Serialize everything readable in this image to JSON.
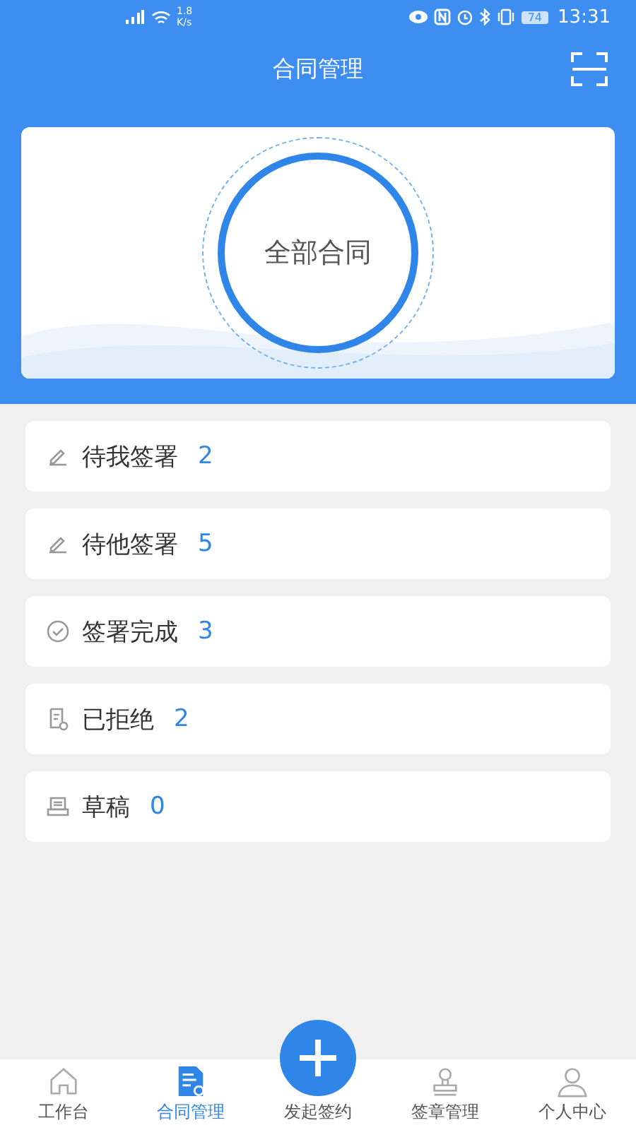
{
  "status_bar": {
    "speed": "1.8",
    "speed_unit": "K/s",
    "battery": "74",
    "time": "13:31"
  },
  "header": {
    "title": "合同管理"
  },
  "summary": {
    "label": "全部合同"
  },
  "items": [
    {
      "kind": "pen",
      "label": "待我签署",
      "count": "2"
    },
    {
      "kind": "pen",
      "label": "待他签署",
      "count": "5"
    },
    {
      "kind": "check",
      "label": "签署完成",
      "count": "3"
    },
    {
      "kind": "rejected",
      "label": "已拒绝",
      "count": "2"
    },
    {
      "kind": "draft",
      "label": "草稿",
      "count": "0"
    }
  ],
  "nav": [
    {
      "kind": "home",
      "label": "工作台",
      "selected": false
    },
    {
      "kind": "contract",
      "label": "合同管理",
      "selected": true
    },
    {
      "kind": "add",
      "label": "发起签约",
      "selected": false
    },
    {
      "kind": "seal",
      "label": "签章管理",
      "selected": false
    },
    {
      "kind": "person",
      "label": "个人中心",
      "selected": false
    }
  ]
}
